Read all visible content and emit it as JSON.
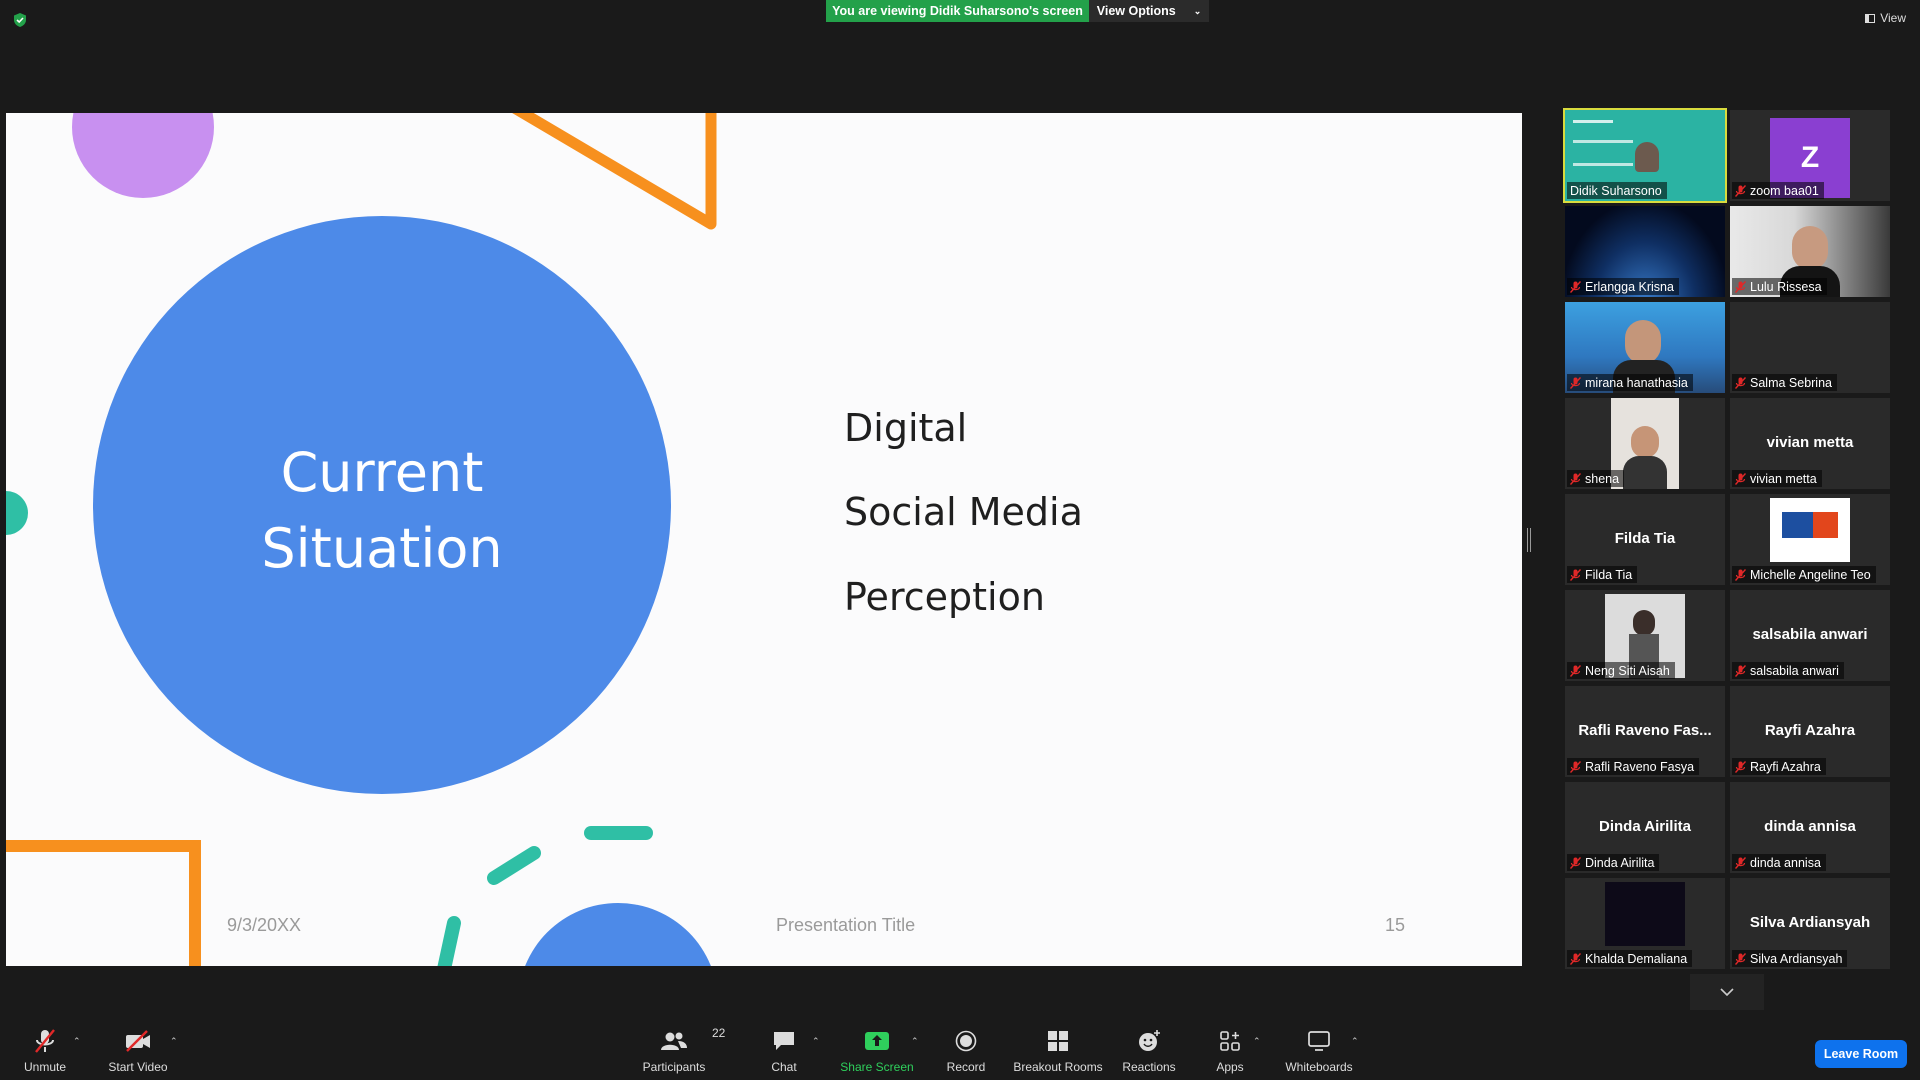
{
  "top": {
    "viewing_banner": "You are viewing Didik Suharsono's screen",
    "view_options": "View Options",
    "view_label": "View"
  },
  "slide": {
    "circle_title_line1": "Current",
    "circle_title_line2": "Situation",
    "items": [
      "Digital",
      "Social Media",
      "Perception"
    ],
    "footer_date": "9/3/20XX",
    "footer_title": "Presentation Title",
    "footer_page": "15",
    "colors": {
      "big_circle": "#4d8ae8",
      "purple": "#c890f0",
      "orange": "#f7901e",
      "teal": "#2fbfa5"
    }
  },
  "gallery": {
    "tiles": [
      {
        "name": "Didik Suharsono",
        "center": "",
        "muted": false,
        "active": true,
        "kind": "video-slide"
      },
      {
        "name": "zoom baa01",
        "center": "",
        "muted": true,
        "active": false,
        "kind": "avatar-z",
        "avatar_letter": "Z"
      },
      {
        "name": "Erlangga Krisna",
        "center": "",
        "muted": true,
        "active": false,
        "kind": "video-earth"
      },
      {
        "name": "Lulu Rissesa",
        "center": "",
        "muted": true,
        "active": false,
        "kind": "video-person"
      },
      {
        "name": "mirana hanathasia",
        "center": "",
        "muted": true,
        "active": false,
        "kind": "video-city"
      },
      {
        "name": "Salma Sebrina",
        "center": "",
        "muted": true,
        "active": false,
        "kind": "blank"
      },
      {
        "name": "shena",
        "center": "",
        "muted": true,
        "active": false,
        "kind": "video-portrait"
      },
      {
        "name": "vivian metta",
        "center": "vivian metta",
        "muted": true,
        "active": false,
        "kind": "name"
      },
      {
        "name": "Filda Tia",
        "center": "Filda Tia",
        "muted": true,
        "active": false,
        "kind": "name"
      },
      {
        "name": "Michelle Angeline Teo",
        "center": "",
        "muted": true,
        "active": false,
        "kind": "logo"
      },
      {
        "name": "Neng Siti Aisah",
        "center": "",
        "muted": true,
        "active": false,
        "kind": "video-photo"
      },
      {
        "name": "salsabila anwari",
        "center": "salsabila anwari",
        "muted": true,
        "active": false,
        "kind": "name"
      },
      {
        "name": "Rafli Raveno Fasya",
        "center": "Rafli Raveno Fas...",
        "muted": true,
        "active": false,
        "kind": "name"
      },
      {
        "name": "Rayfi Azahra",
        "center": "Rayfi Azahra",
        "muted": true,
        "active": false,
        "kind": "name"
      },
      {
        "name": "Dinda Airilita",
        "center": "Dinda Airilita",
        "muted": true,
        "active": false,
        "kind": "name"
      },
      {
        "name": "dinda annisa",
        "center": "dinda annisa",
        "muted": true,
        "active": false,
        "kind": "name"
      },
      {
        "name": "Khalda Demaliana",
        "center": "",
        "muted": true,
        "active": false,
        "kind": "dark"
      },
      {
        "name": "Silva Ardiansyah",
        "center": "Silva Ardiansyah",
        "muted": true,
        "active": false,
        "kind": "name"
      }
    ]
  },
  "toolbar": {
    "unmute": "Unmute",
    "start_video": "Start Video",
    "participants": "Participants",
    "participants_count": "22",
    "chat": "Chat",
    "share_screen": "Share Screen",
    "record": "Record",
    "breakout_rooms": "Breakout Rooms",
    "reactions": "Reactions",
    "apps": "Apps",
    "whiteboards": "Whiteboards",
    "leave_room": "Leave Room"
  }
}
